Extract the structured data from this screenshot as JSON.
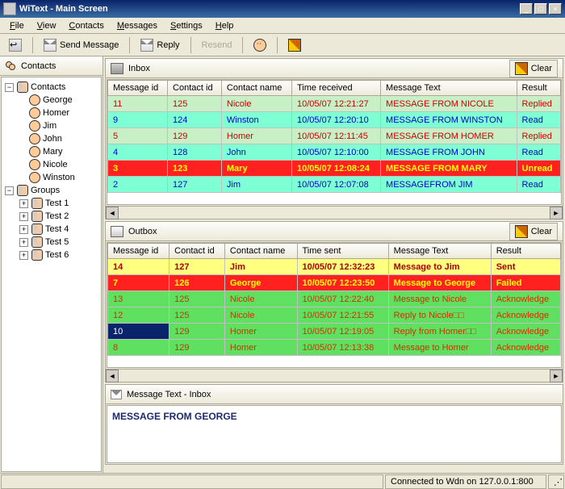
{
  "window": {
    "title": "WiText - Main Screen"
  },
  "menu": {
    "file": "File",
    "view": "View",
    "contacts": "Contacts",
    "messages": "Messages",
    "settings": "Settings",
    "help": "Help"
  },
  "toolbar": {
    "send": "Send Message",
    "reply": "Reply",
    "resend": "Resend",
    "clear": "Clear"
  },
  "sidebar": {
    "title": "Contacts",
    "root": "Contacts",
    "contacts": [
      "George",
      "Homer",
      "Jim",
      "John",
      "Mary",
      "Nicole",
      "Winston"
    ],
    "groups_label": "Groups",
    "groups": [
      "Test 1",
      "Test 2",
      "Test 4",
      "Test 5",
      "Test 6"
    ]
  },
  "inbox": {
    "title": "Inbox",
    "cols": {
      "c0": "Message id",
      "c1": "Contact id",
      "c2": "Contact name",
      "c3": "Time received",
      "c4": "Message Text",
      "c5": "Result"
    },
    "rows": [
      {
        "id": "11",
        "cid": "125",
        "name": "Nicole",
        "time": "10/05/07 12:21:27",
        "msg": "MESSAGE FROM NICOLE",
        "res": "Replied",
        "cls": "palegreen"
      },
      {
        "id": "9",
        "cid": "124",
        "name": "Winston",
        "time": "10/05/07 12:20:10",
        "msg": "MESSAGE FROM WINSTON",
        "res": "Read",
        "cls": "cyan"
      },
      {
        "id": "5",
        "cid": "129",
        "name": "Homer",
        "time": "10/05/07 12:11:45",
        "msg": "MESSAGE FROM HOMER",
        "res": "Replied",
        "cls": "palegreen"
      },
      {
        "id": "4",
        "cid": "128",
        "name": "John",
        "time": "10/05/07 12:10:00",
        "msg": "MESSAGE FROM JOHN",
        "res": "Read",
        "cls": "cyan"
      },
      {
        "id": "3",
        "cid": "123",
        "name": "Mary",
        "time": "10/05/07 12:08:24",
        "msg": "MESSAGE FROM MARY",
        "res": "Unread",
        "cls": "red"
      },
      {
        "id": "2",
        "cid": "127",
        "name": "Jim",
        "time": "10/05/07 12:07:08",
        "msg": "MESSAGEFROM JIM",
        "res": "Read",
        "cls": "cyan"
      }
    ]
  },
  "outbox": {
    "title": "Outbox",
    "cols": {
      "c0": "Message id",
      "c1": "Contact id",
      "c2": "Contact name",
      "c3": "Time sent",
      "c4": "Message Text",
      "c5": "Result"
    },
    "rows": [
      {
        "id": "14",
        "cid": "127",
        "name": "Jim",
        "time": "10/05/07 12:32:23",
        "msg": "Message to Jim",
        "res": "Sent",
        "cls": "yellow"
      },
      {
        "id": "7",
        "cid": "126",
        "name": "George",
        "time": "10/05/07 12:23:50",
        "msg": "Message to George",
        "res": "Failed",
        "cls": "red"
      },
      {
        "id": "13",
        "cid": "125",
        "name": "Nicole",
        "time": "10/05/07 12:22:40",
        "msg": "Message to Nicole",
        "res": "Acknowledge",
        "cls": "green"
      },
      {
        "id": "12",
        "cid": "125",
        "name": "Nicole",
        "time": "10/05/07 12:21:55",
        "msg": "Reply to Nicole□□",
        "res": "Acknowledge",
        "cls": "green"
      },
      {
        "id": "10",
        "cid": "129",
        "name": "Homer",
        "time": "10/05/07 12:19:05",
        "msg": "Reply from Homer□□",
        "res": "Acknowledge",
        "cls": "green",
        "sel": true
      },
      {
        "id": "8",
        "cid": "129",
        "name": "Homer",
        "time": "10/05/07 12:13:38",
        "msg": "Message to Homer",
        "res": "Acknowledge",
        "cls": "green"
      }
    ]
  },
  "msgpanel": {
    "title": "Message Text - Inbox",
    "body": "MESSAGE FROM GEORGE"
  },
  "status": {
    "conn": "Connected to Wdn on 127.0.0.1:800"
  }
}
